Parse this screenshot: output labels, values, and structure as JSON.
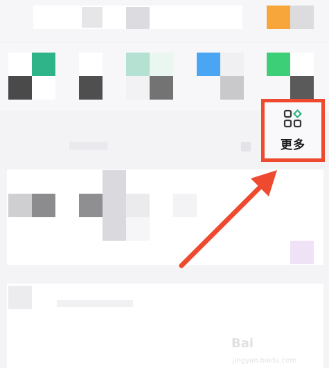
{
  "more_button": {
    "label": "更多",
    "icon": "grid-more-icon",
    "icon_accent": "#2fb37d"
  },
  "annotation": {
    "highlight_color": "#ee4a2f",
    "arrow_color": "#ee4a2f"
  },
  "watermark": {
    "brand": "Bai",
    "sub": "jingyan.baidu.com"
  }
}
